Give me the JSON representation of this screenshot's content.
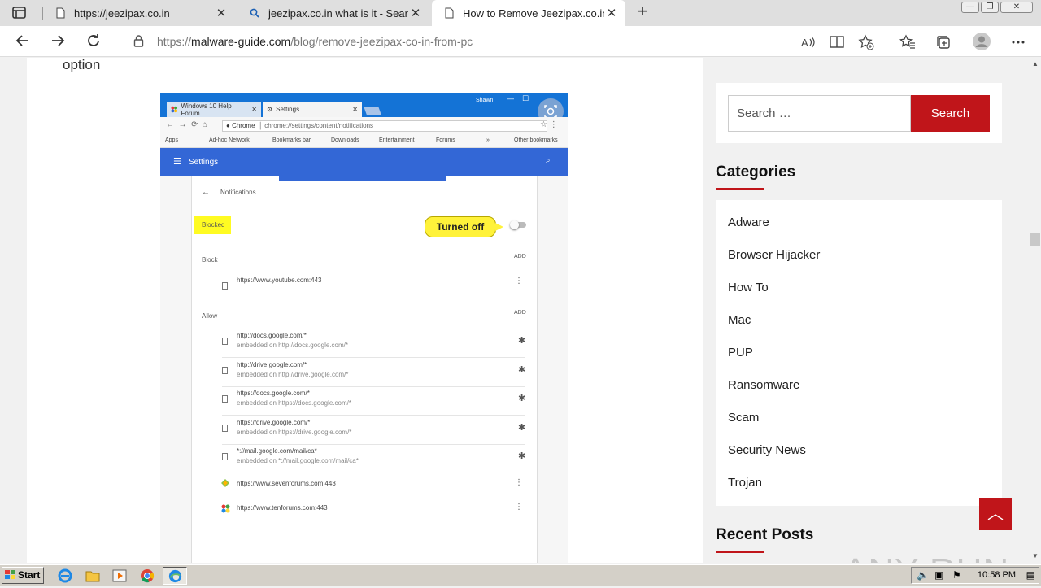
{
  "browser": {
    "tabs": [
      {
        "title": "https://jeezipax.co.in",
        "close": "✕"
      },
      {
        "title": "jeezipax.co.in what is it - Search",
        "close": "✕"
      },
      {
        "title": "How to Remove Jeezipax.co.in f",
        "close": "✕",
        "active": true
      }
    ],
    "new_tab": "+",
    "window_buttons": {
      "minimize": "—",
      "restore": "❐",
      "close": "✕"
    },
    "address": {
      "prefix": "https://",
      "domain": "malware-guide.com",
      "path": "/blog/remove-jeezipax-co-in-from-pc"
    }
  },
  "article": {
    "option_text": "option",
    "screenshot": {
      "tabs": [
        "Windows 10 Help Forum",
        "Settings"
      ],
      "profile": "Shawn",
      "omnibox_label": "Chrome",
      "omnibox_url": "chrome://settings/content/notifications",
      "bookmarks": [
        "Apps",
        "Ad-hoc Network",
        "Bookmarks bar",
        "Downloads",
        "Entertainment",
        "Forums",
        "»",
        "Other bookmarks"
      ],
      "header_title": "Settings",
      "page_title": "Notifications",
      "blocked_label": "Blocked",
      "callout": "Turned off",
      "block_section": "Block",
      "allow_section": "Allow",
      "add_label": "ADD",
      "block_sites": [
        "https://www.youtube.com:443"
      ],
      "allow_sites": [
        {
          "url": "http://docs.google.com/*",
          "sub": "embedded on http://docs.google.com/*"
        },
        {
          "url": "http://drive.google.com/*",
          "sub": "embedded on http://drive.google.com/*"
        },
        {
          "url": "https://docs.google.com/*",
          "sub": "embedded on https://docs.google.com/*"
        },
        {
          "url": "https://drive.google.com/*",
          "sub": "embedded on https://drive.google.com/*"
        },
        {
          "url": "*://mail.google.com/mail/ca*",
          "sub": "embedded on *://mail.google.com/mail/ca*"
        },
        {
          "url": "https://www.sevenforums.com:443",
          "sub": ""
        },
        {
          "url": "https://www.tenforums.com:443",
          "sub": ""
        }
      ]
    }
  },
  "sidebar": {
    "search": {
      "placeholder": "Search …",
      "button": "Search"
    },
    "categories_title": "Categories",
    "categories": [
      "Adware",
      "Browser Hijacker",
      "How To",
      "Mac",
      "PUP",
      "Ransomware",
      "Scam",
      "Security News",
      "Trojan"
    ],
    "recent_title": "Recent Posts"
  },
  "scroll_top": "︿",
  "watermark": "ANY RUN",
  "taskbar": {
    "start": "Start",
    "clock": "10:58 PM"
  },
  "colors": {
    "accent": "#c0151a",
    "chrome_blue": "#3367d6",
    "highlight": "#fffb22"
  }
}
